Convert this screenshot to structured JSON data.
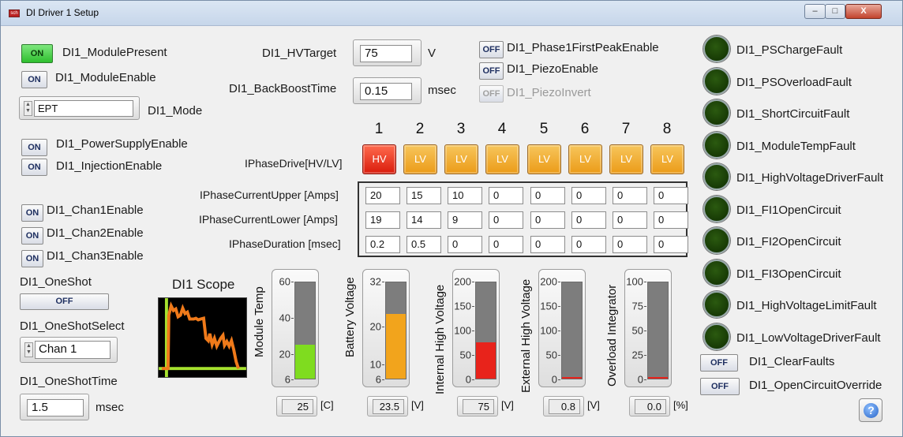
{
  "window": {
    "title": "DI Driver 1 Setup",
    "app_icon": "app-icon-red",
    "min": "–",
    "max": "□",
    "close": "X"
  },
  "left": {
    "module_present": {
      "state": "ON",
      "label": "DI1_ModulePresent"
    },
    "module_enable": {
      "state": "ON",
      "label": "DI1_ModuleEnable"
    },
    "mode": {
      "value": "EPT",
      "label": "DI1_Mode"
    },
    "power_supply_enable": {
      "state": "ON",
      "label": "DI1_PowerSupplyEnable"
    },
    "injection_enable": {
      "state": "ON",
      "label": "DI1_InjectionEnable"
    },
    "chan1_enable": {
      "state": "ON",
      "label": "DI1_Chan1Enable"
    },
    "chan2_enable": {
      "state": "ON",
      "label": "DI1_Chan2Enable"
    },
    "chan3_enable": {
      "state": "ON",
      "label": "DI1_Chan3Enable"
    },
    "one_shot": {
      "label": "DI1_OneShot",
      "state": "OFF"
    },
    "one_shot_select": {
      "label": "DI1_OneShotSelect",
      "value": "Chan 1"
    },
    "one_shot_time": {
      "label": "DI1_OneShotTime",
      "value": "1.5",
      "unit": "msec"
    }
  },
  "settings": {
    "hv_target": {
      "label": "DI1_HVTarget",
      "value": "75",
      "unit": "V"
    },
    "back_boost": {
      "label": "DI1_BackBoostTime",
      "value": "0.15",
      "unit": "msec"
    },
    "phase1_first_peak": {
      "state": "OFF",
      "label": "DI1_Phase1FirstPeakEnable"
    },
    "piezo_enable": {
      "state": "OFF",
      "label": "DI1_PiezoEnable"
    },
    "piezo_invert": {
      "state": "OFF",
      "label": "DI1_PiezoInvert"
    }
  },
  "phase": {
    "columns": [
      "1",
      "2",
      "3",
      "4",
      "5",
      "6",
      "7",
      "8"
    ],
    "drive_label": "IPhaseDrive[HV/LV]",
    "drive": [
      "HV",
      "LV",
      "LV",
      "LV",
      "LV",
      "LV",
      "LV",
      "LV"
    ],
    "rows": [
      {
        "label": "IPhaseCurrentUpper [Amps]",
        "values": [
          "20",
          "15",
          "10",
          "0",
          "0",
          "0",
          "0",
          "0"
        ]
      },
      {
        "label": "IPhaseCurrentLower [Amps]",
        "values": [
          "19",
          "14",
          "9",
          "0",
          "0",
          "0",
          "0",
          "0"
        ]
      },
      {
        "label": "IPhaseDuration [msec]",
        "values": [
          "0.2",
          "0.5",
          "0",
          "0",
          "0",
          "0",
          "0",
          "0"
        ]
      }
    ]
  },
  "scope": {
    "title": "DI1 Scope"
  },
  "meters": [
    {
      "label": "Module Temp",
      "ticks": [
        "60",
        "40",
        "20",
        "6"
      ],
      "min": 6,
      "max": 60,
      "value": 25,
      "display": "25",
      "unit": "[C]",
      "fill": "#7fdc1f"
    },
    {
      "label": "Battery Voltage",
      "ticks": [
        "32",
        "20",
        "10",
        "6"
      ],
      "min": 6,
      "max": 32,
      "value": 23.5,
      "display": "23.5",
      "unit": "[V]",
      "fill": "#f2a41c"
    },
    {
      "label": "Internal High Voltage",
      "ticks": [
        "200",
        "150",
        "100",
        "50",
        "0"
      ],
      "min": 0,
      "max": 200,
      "value": 75,
      "display": "75",
      "unit": "[V]",
      "fill": "#e8231b"
    },
    {
      "label": "External High Voltage",
      "ticks": [
        "200",
        "150",
        "100",
        "50",
        "0"
      ],
      "min": 0,
      "max": 200,
      "value": 0.8,
      "display": "0.8",
      "unit": "[V]",
      "fill": "#e8231b"
    },
    {
      "label": "Overload Integrator",
      "ticks": [
        "100",
        "75",
        "50",
        "25",
        "0"
      ],
      "min": 0,
      "max": 100,
      "value": 0,
      "display": "0.0",
      "unit": "[%]",
      "fill": "#e8231b"
    }
  ],
  "faults": [
    "DI1_PSChargeFault",
    "DI1_PSOverloadFault",
    "DI1_ShortCircuitFault",
    "DI1_ModuleTempFault",
    "DI1_HighVoltageDriverFault",
    "DI1_FI1OpenCircuit",
    "DI1_FI2OpenCircuit",
    "DI1_FI3OpenCircuit",
    "DI1_HighVoltageLimitFault",
    "DI1_LowVoltageDriverFault"
  ],
  "clear_faults": {
    "state": "OFF",
    "label": "DI1_ClearFaults"
  },
  "open_circuit_override": {
    "state": "OFF",
    "label": "DI1_OpenCircuitOverride"
  },
  "help": "?"
}
